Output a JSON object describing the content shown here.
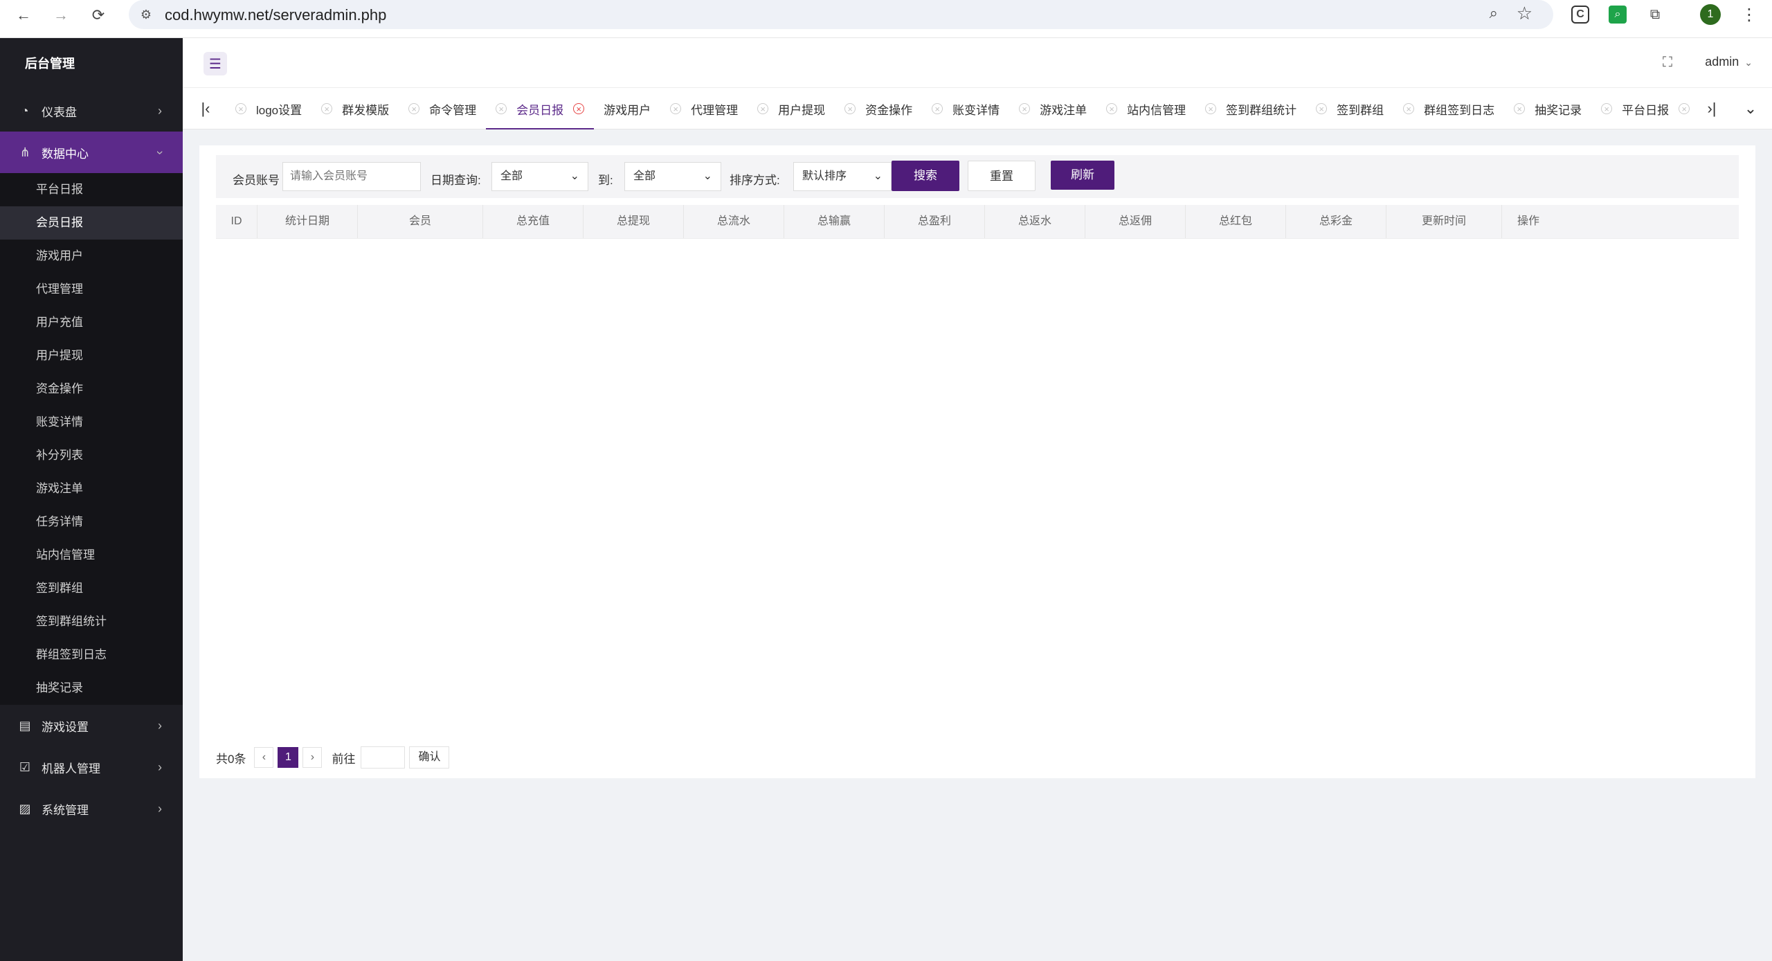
{
  "browser": {
    "url": "cod.hwymw.net/serveradmin.php",
    "profile_initial": "1"
  },
  "sidebar": {
    "brand": "后台管理",
    "menus": [
      {
        "label": "仪表盘",
        "icon": "dashboard-icon"
      },
      {
        "label": "数据中心",
        "icon": "sitemap-icon",
        "active": true
      },
      {
        "label": "游戏设置",
        "icon": "clipboard-icon"
      },
      {
        "label": "机器人管理",
        "icon": "checkbox-icon"
      },
      {
        "label": "系统管理",
        "icon": "image-icon"
      }
    ],
    "submenu": [
      "平台日报",
      "会员日报",
      "游戏用户",
      "代理管理",
      "用户充值",
      "用户提现",
      "资金操作",
      "账变详情",
      "补分列表",
      "游戏注单",
      "任务详情",
      "站内信管理",
      "签到群组",
      "签到群组统计",
      "群组签到日志",
      "抽奖记录"
    ],
    "selected_sub": "会员日报"
  },
  "header": {
    "user": "admin"
  },
  "tabs": [
    {
      "label": "logo设置"
    },
    {
      "label": "群发模版"
    },
    {
      "label": "命令管理"
    },
    {
      "label": "会员日报",
      "active": true
    },
    {
      "label": "游戏用户"
    },
    {
      "label": "代理管理"
    },
    {
      "label": "用户提现"
    },
    {
      "label": "资金操作"
    },
    {
      "label": "账变详情"
    },
    {
      "label": "游戏注单"
    },
    {
      "label": "站内信管理"
    },
    {
      "label": "签到群组统计"
    },
    {
      "label": "签到群组"
    },
    {
      "label": "群组签到日志"
    },
    {
      "label": "抽奖记录"
    },
    {
      "label": "平台日报"
    }
  ],
  "filters": {
    "account_label": "会员账号",
    "account_placeholder": "请输入会员账号",
    "date_label": "日期查询:",
    "date_from": "全部",
    "to_label": "到:",
    "date_to": "全部",
    "sort_label": "排序方式:",
    "sort_value": "默认排序",
    "search": "搜索",
    "reset": "重置",
    "refresh": "刷新"
  },
  "table": {
    "columns": [
      "ID",
      "统计日期",
      "会员",
      "总充值",
      "总提现",
      "总流水",
      "总输赢",
      "总盈利",
      "总返水",
      "总返佣",
      "总红包",
      "总彩金",
      "更新时间",
      "操作"
    ],
    "rows": []
  },
  "pager": {
    "total": "共0条",
    "current_page": "1",
    "goto": "前往",
    "confirm": "确认"
  },
  "colors": {
    "accent": "#5c2a8a",
    "sidebar_bg": "#1e1e24"
  }
}
